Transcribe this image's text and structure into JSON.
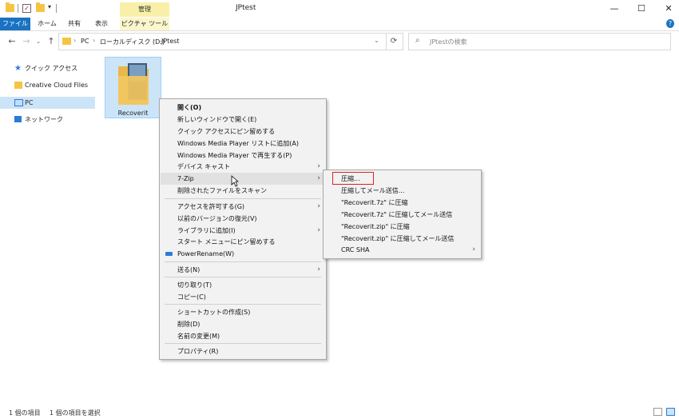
{
  "window": {
    "title": "JPtest",
    "minimize": "—",
    "maximize": "☐",
    "close": "✕"
  },
  "ribbon": {
    "context_group": "管理",
    "tabs": [
      "ファイル",
      "ホーム",
      "共有",
      "表示",
      "ピクチャ ツール"
    ]
  },
  "address": {
    "crumbs": [
      "PC",
      "ローカルディスク (D:)",
      "JPtest"
    ],
    "search_placeholder": "JPtestの検索"
  },
  "nav": {
    "items": [
      "クイック アクセス",
      "Creative Cloud Files",
      "PC",
      "ネットワーク"
    ]
  },
  "file": {
    "name": "Recoverit"
  },
  "context_menu": {
    "open": "開く(O)",
    "open_new_window": "新しいウィンドウで開く(E)",
    "pin_quick_access": "クイック アクセスにピン留めする",
    "wmp_add_list": "Windows Media Player リストに追加(A)",
    "wmp_play": "Windows Media Player で再生する(P)",
    "cast_to_device": "デバイス キャスト",
    "seven_zip": "7-Zip",
    "scan_deleted": "削除されたファイルをスキャン",
    "give_access": "アクセスを許可する(G)",
    "restore_versions": "以前のバージョンの復元(V)",
    "include_library": "ライブラリに追加(I)",
    "pin_start": "スタート メニューにピン留めする",
    "powerrename": "PowerRename(W)",
    "send_to": "送る(N)",
    "cut": "切り取り(T)",
    "copy": "コピー(C)",
    "create_shortcut": "ショートカットの作成(S)",
    "delete": "削除(D)",
    "rename": "名前の変更(M)",
    "properties": "プロパティ(R)"
  },
  "submenu": {
    "compress": "圧縮...",
    "compress_email": "圧縮してメール送信...",
    "compress_7z": "\"Recoverit.7z\" に圧縮",
    "compress_7z_email": "\"Recoverit.7z\" に圧縮してメール送信",
    "compress_zip": "\"Recoverit.zip\" に圧縮",
    "compress_zip_email": "\"Recoverit.zip\" に圧縮してメール送信",
    "crc_sha": "CRC SHA"
  },
  "status": {
    "item_count": "1 個の項目",
    "selected": "1 個の項目を選択"
  },
  "colors": {
    "file_tab": "#1a73c2",
    "selection": "#cce4f7",
    "context_tab": "#f8f0a8",
    "highlight_box": "#e02020"
  }
}
